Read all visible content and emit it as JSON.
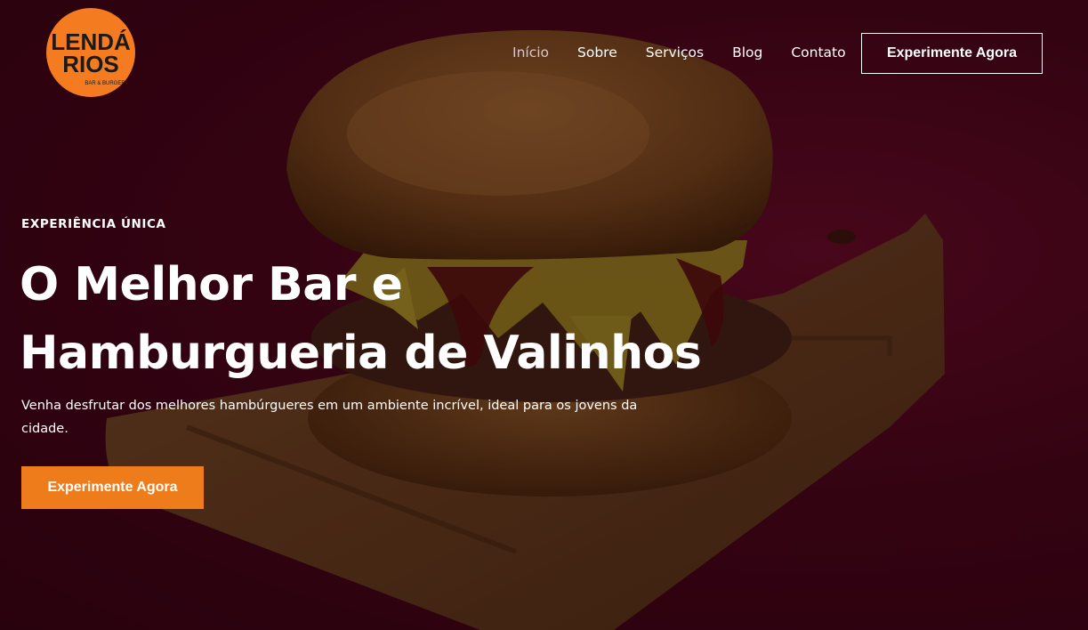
{
  "brand": {
    "logo_line1": "LENDÁ",
    "logo_line2": "RIOS",
    "logo_tagline": "BAR & BURGER"
  },
  "nav": {
    "items": [
      {
        "label": "Início",
        "active": true
      },
      {
        "label": "Sobre",
        "active": false
      },
      {
        "label": "Serviços",
        "active": false
      },
      {
        "label": "Blog",
        "active": false
      },
      {
        "label": "Contato",
        "active": false
      }
    ],
    "cta_label": "Experimente Agora"
  },
  "hero": {
    "eyebrow": "EXPERIÊNCIA ÚNICA",
    "headline_line1": "O Melhor Bar e",
    "headline_line2": "Hamburgueria de Valinhos",
    "subtitle": "Venha desfrutar dos melhores hambúrgueres em um ambiente incrível, ideal para os jovens da cidade.",
    "cta_label": "Experimente Agora",
    "image": "burger-on-wooden-board-photo"
  },
  "colors": {
    "background": "#3b0415",
    "accent": "#ef7c1b",
    "logo_orange": "#f47b20",
    "text": "#ffffff"
  }
}
